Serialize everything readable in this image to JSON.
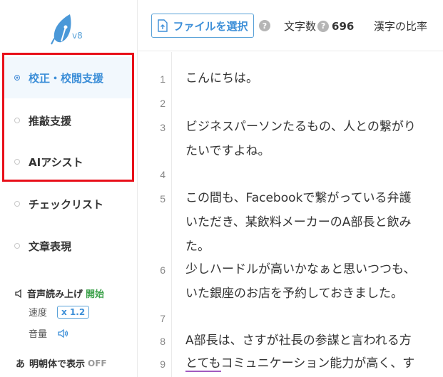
{
  "logo": {
    "version": "v8"
  },
  "nav": [
    {
      "label": "校正・校閲支援",
      "active": true
    },
    {
      "label": "推敲支援",
      "active": false
    },
    {
      "label": "AIアシスト",
      "active": false
    },
    {
      "label": "チェックリスト",
      "active": false
    },
    {
      "label": "文章表現",
      "active": false
    }
  ],
  "tools": {
    "tts_label": "音声読み上げ",
    "tts_start": "開始",
    "speed_label": "速度",
    "speed_value": "x 1.2",
    "volume_label": "音量",
    "mincho_icon": "あ",
    "mincho_label": "明朝体で表示",
    "mincho_state": "OFF"
  },
  "toolbar": {
    "file_button": "ファイルを選択",
    "char_count_label": "文字数",
    "char_count_value": "696",
    "kanji_ratio_label": "漢字の比率"
  },
  "editor": {
    "line_numbers": [
      "1",
      "2",
      "3",
      "",
      "4",
      "5",
      "",
      "",
      "6",
      "",
      "7",
      "8",
      "9"
    ],
    "lines": [
      "こんにちは。",
      "",
      "ビジネスパーソンたるもの、人との繋がり",
      "たいですよね。",
      "",
      "この間も、Facebookで繋がっている弁護",
      "いただき、某飲料メーカーのA部長と飲み",
      "た。",
      "少しハードルが高いかなぁと思いつつも、",
      "いた銀座のお店を予約しておきました。",
      "",
      "A部長は、さすが社長の参謀と言われる方",
      "コミュニケーション能力が高く、す"
    ],
    "underlined_prefix": "とても"
  },
  "colors": {
    "accent": "#3d8fd8",
    "highlight": "#e8101a",
    "start_green": "#3fa34d"
  }
}
